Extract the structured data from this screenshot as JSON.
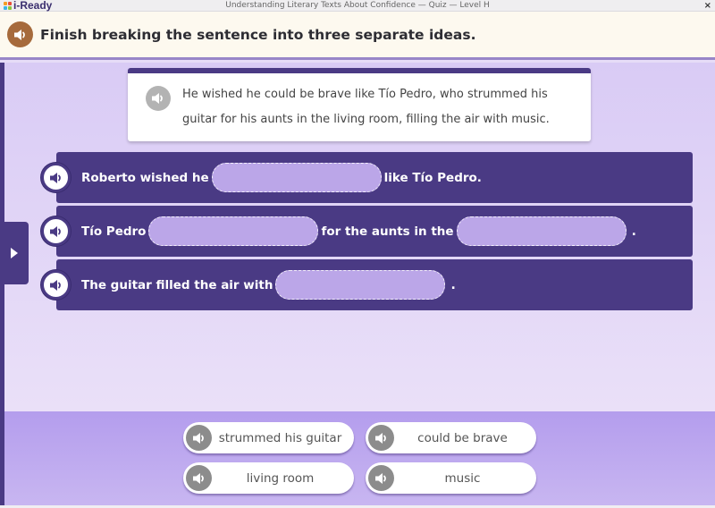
{
  "window": {
    "logo_text": "i-Ready",
    "title": "Understanding Literary Texts About Confidence — Quiz — Level H",
    "close_glyph": "×"
  },
  "instruction": {
    "text": "Finish breaking the sentence into three separate ideas.",
    "audio_icon": "speaker-icon"
  },
  "passage": {
    "text": "He wished he could be brave like Tío Pedro, who strummed his guitar for his aunts in the living room, filling the air with music.",
    "audio_icon": "speaker-icon"
  },
  "side_tab": {
    "icon": "triangle-right-icon"
  },
  "sentences": [
    {
      "parts": [
        "Roberto wished he",
        "like Tío Pedro."
      ],
      "blanks": [
        ""
      ]
    },
    {
      "parts": [
        "Tío Pedro",
        "for the aunts in the",
        "."
      ],
      "blanks": [
        "",
        ""
      ]
    },
    {
      "parts": [
        "The guitar filled the air with",
        "."
      ],
      "blanks": [
        ""
      ]
    }
  ],
  "answer_bank": [
    {
      "label": "strummed his guitar"
    },
    {
      "label": "could be brave"
    },
    {
      "label": "living room"
    },
    {
      "label": "music"
    }
  ],
  "colors": {
    "primary_purple": "#4a3a84",
    "blank_fill": "#bba6e8",
    "instruction_audio": "#a66a3c",
    "chip_audio": "#8c8c8c",
    "header_bg": "#fdf9ef"
  }
}
